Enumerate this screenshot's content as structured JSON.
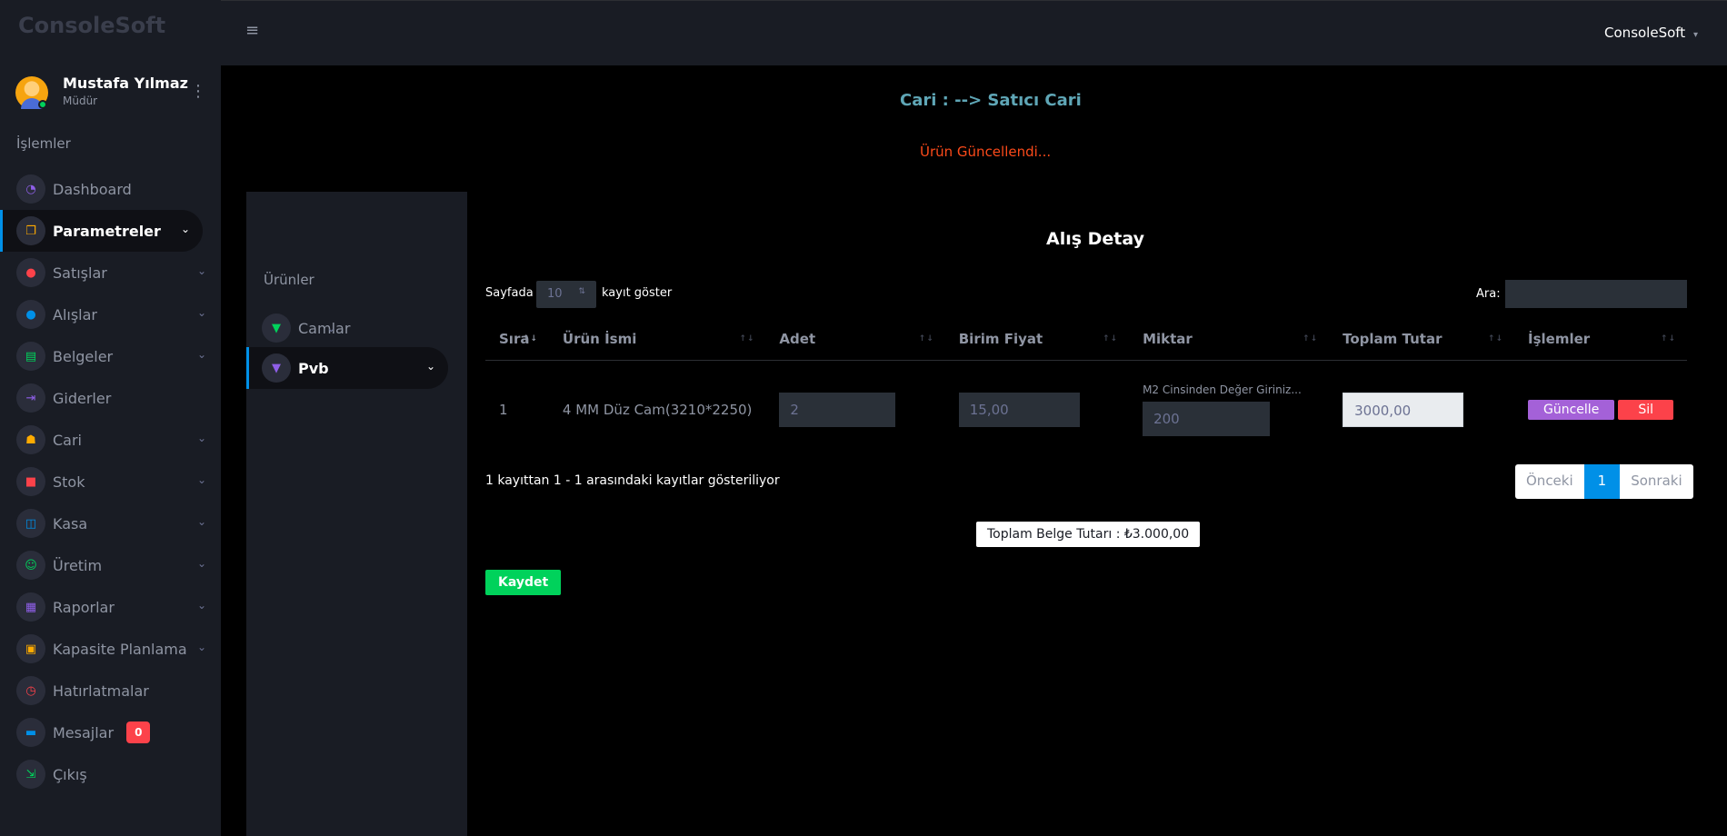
{
  "app": {
    "brand": "ConsoleSoft"
  },
  "header": {
    "user_menu": "ConsoleSoft"
  },
  "profile": {
    "name": "Mustafa Yılmaz",
    "role": "Müdür"
  },
  "sidebar": {
    "section_title": "İşlemler",
    "items": [
      {
        "label": "Dashboard",
        "icon": "speedometer-icon",
        "color": "#8f5fe8",
        "glyph": "◔",
        "chevron": false
      },
      {
        "label": "Parametreler",
        "icon": "layers-icon",
        "color": "#ffab00",
        "glyph": "❐",
        "chevron": true,
        "active": true
      },
      {
        "label": "Satışlar",
        "icon": "record-icon",
        "color": "#fc424a",
        "glyph": "●",
        "chevron": true
      },
      {
        "label": "Alışlar",
        "icon": "cart-icon",
        "color": "#0090e7",
        "glyph": "●",
        "chevron": true
      },
      {
        "label": "Belgeler",
        "icon": "book-icon",
        "color": "#00d25b",
        "glyph": "▤",
        "chevron": true
      },
      {
        "label": "Giderler",
        "icon": "arrow-right-icon",
        "color": "#8f5fe8",
        "glyph": "⇥",
        "chevron": false
      },
      {
        "label": "Cari",
        "icon": "users-icon",
        "color": "#ffab00",
        "glyph": "☗",
        "chevron": true
      },
      {
        "label": "Stok",
        "icon": "box-icon",
        "color": "#fc424a",
        "glyph": "■",
        "chevron": true
      },
      {
        "label": "Kasa",
        "icon": "cashbox-icon",
        "color": "#0090e7",
        "glyph": "◫",
        "chevron": true
      },
      {
        "label": "Üretim",
        "icon": "robot-icon",
        "color": "#00d25b",
        "glyph": "☺",
        "chevron": true
      },
      {
        "label": "Raporlar",
        "icon": "report-icon",
        "color": "#8f5fe8",
        "glyph": "▦",
        "chevron": true
      },
      {
        "label": "Kapasite Planlama",
        "icon": "clipboard-icon",
        "color": "#ffab00",
        "glyph": "▣",
        "chevron": true
      },
      {
        "label": "Hatırlatmalar",
        "icon": "timer-icon",
        "color": "#fc424a",
        "glyph": "◷",
        "chevron": false
      },
      {
        "label": "Mesajlar",
        "icon": "message-icon",
        "color": "#0090e7",
        "glyph": "▬",
        "chevron": false,
        "badge": "0"
      },
      {
        "label": "Çıkış",
        "icon": "logout-icon",
        "color": "#00d25b",
        "glyph": "⇲",
        "chevron": false
      }
    ]
  },
  "page": {
    "breadcrumb": "Cari : --> Satıcı Cari",
    "alert": "Ürün Güncellendi..."
  },
  "subpanel": {
    "title": "Ürünler",
    "items": [
      {
        "label": "Camlar",
        "icon": "cup-icon",
        "color": "#00d25b"
      },
      {
        "label": "Pvb",
        "icon": "cup-icon",
        "color": "#8f5fe8",
        "active": true
      }
    ]
  },
  "detail": {
    "title": "Alış Detay",
    "length_prefix": "Sayfada",
    "length_value": "10",
    "length_suffix": "kayıt göster",
    "search_label": "Ara:",
    "columns": [
      "Sıra",
      "Ürün İsmi",
      "Adet",
      "Birim Fiyat",
      "Miktar",
      "Toplam Tutar",
      "İşlemler"
    ],
    "rows": [
      {
        "sira": "1",
        "urun": "4 MM Düz Cam(3210*2250)",
        "adet": "2",
        "birim_fiyat": "15,00",
        "miktar_hint": "M2 Cinsinden Değer Giriniz...",
        "miktar": "200",
        "toplam": "3000,00",
        "btn_update": "Güncelle",
        "btn_delete": "Sil"
      }
    ],
    "info": "1 kayıttan 1 - 1 arasındaki kayıtlar gösteriliyor",
    "pager": {
      "prev": "Önceki",
      "current": "1",
      "next": "Sonraki"
    },
    "total": "Toplam Belge Tutarı : ₺3.000,00",
    "save": "Kaydet"
  }
}
